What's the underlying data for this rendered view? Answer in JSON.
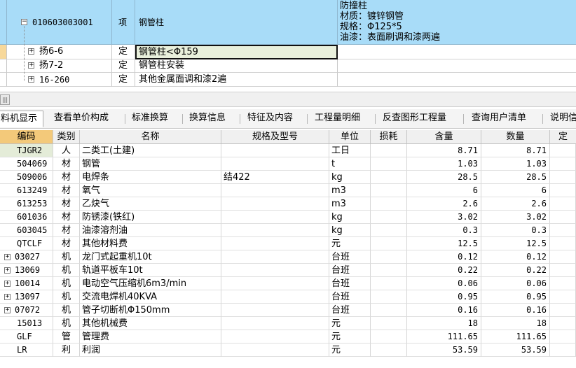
{
  "top_grid": {
    "main": {
      "code": "010603003001",
      "type": "项",
      "name": "钢管柱",
      "desc_lines": [
        "防撞柱",
        "材质：镀锌钢管",
        "规格：Φ125*5",
        "油漆：表面刷调和漆两遍"
      ]
    },
    "subs": [
      {
        "code": "扬6-6",
        "type": "定",
        "name": "钢管柱<Φ159"
      },
      {
        "code": "扬7-2",
        "type": "定",
        "name": "钢管柱安装"
      },
      {
        "code": "16-260",
        "type": "定",
        "name": "其他金属面调和漆2遍"
      }
    ]
  },
  "splitter": {
    "handle": "|||"
  },
  "tabs": [
    "料机显示",
    "查看单价构成",
    "标准换算",
    "换算信息",
    "特征及内容",
    "工程量明细",
    "反查图形工程量",
    "查询用户清单",
    "说明信"
  ],
  "grid": {
    "headers": [
      "编码",
      "类别",
      "名称",
      "规格及型号",
      "单位",
      "损耗",
      "含量",
      "数量",
      "定"
    ],
    "rows": [
      {
        "code": "TJGR2",
        "cat": "人",
        "name": "二类工(土建)",
        "spec": "",
        "unit": "工日",
        "qty": "8.71",
        "amount": "8.71",
        "expand": false
      },
      {
        "code": "504069",
        "cat": "材",
        "name": "钢管",
        "spec": "",
        "unit": "t",
        "qty": "1.03",
        "amount": "1.03",
        "expand": false
      },
      {
        "code": "509006",
        "cat": "材",
        "name": "电焊条",
        "spec": "结422",
        "unit": "kg",
        "qty": "28.5",
        "amount": "28.5",
        "expand": false
      },
      {
        "code": "613249",
        "cat": "材",
        "name": "氧气",
        "spec": "",
        "unit": "m3",
        "qty": "6",
        "amount": "6",
        "expand": false
      },
      {
        "code": "613253",
        "cat": "材",
        "name": "乙炔气",
        "spec": "",
        "unit": "m3",
        "qty": "2.6",
        "amount": "2.6",
        "expand": false
      },
      {
        "code": "601036",
        "cat": "材",
        "name": "防锈漆(铁红)",
        "spec": "",
        "unit": "kg",
        "qty": "3.02",
        "amount": "3.02",
        "expand": false
      },
      {
        "code": "603045",
        "cat": "材",
        "name": "油漆溶剂油",
        "spec": "",
        "unit": "kg",
        "qty": "0.3",
        "amount": "0.3",
        "expand": false
      },
      {
        "code": "QTCLF",
        "cat": "材",
        "name": "其他材料费",
        "spec": "",
        "unit": "元",
        "qty": "12.5",
        "amount": "12.5",
        "expand": false
      },
      {
        "code": "03027",
        "cat": "机",
        "name": "龙门式起重机10t",
        "spec": "",
        "unit": "台班",
        "qty": "0.12",
        "amount": "0.12",
        "expand": true
      },
      {
        "code": "13069",
        "cat": "机",
        "name": "轨道平板车10t",
        "spec": "",
        "unit": "台班",
        "qty": "0.22",
        "amount": "0.22",
        "expand": true
      },
      {
        "code": "10014",
        "cat": "机",
        "name": "电动空气压缩机6m3/min",
        "spec": "",
        "unit": "台班",
        "qty": "0.06",
        "amount": "0.06",
        "expand": true
      },
      {
        "code": "13097",
        "cat": "机",
        "name": "交流电焊机40KVA",
        "spec": "",
        "unit": "台班",
        "qty": "0.95",
        "amount": "0.95",
        "expand": true
      },
      {
        "code": "07072",
        "cat": "机",
        "name": "管子切断机Φ150mm",
        "spec": "",
        "unit": "台班",
        "qty": "0.16",
        "amount": "0.16",
        "expand": true
      },
      {
        "code": "15013",
        "cat": "机",
        "name": "其他机械费",
        "spec": "",
        "unit": "元",
        "qty": "18",
        "amount": "18",
        "expand": false
      },
      {
        "code": "GLF",
        "cat": "管",
        "name": "管理费",
        "spec": "",
        "unit": "元",
        "qty": "111.65",
        "amount": "111.65",
        "expand": false
      },
      {
        "code": "LR",
        "cat": "利",
        "name": "利润",
        "spec": "",
        "unit": "元",
        "qty": "53.59",
        "amount": "53.59",
        "expand": false
      }
    ]
  },
  "colors": {
    "main_row": "#a8dcf8",
    "header_code": "#f3c97a",
    "selected_code": "#e4ecd8",
    "editing_cell": "#e9f0dc",
    "row_marker": "#f7d89a"
  }
}
